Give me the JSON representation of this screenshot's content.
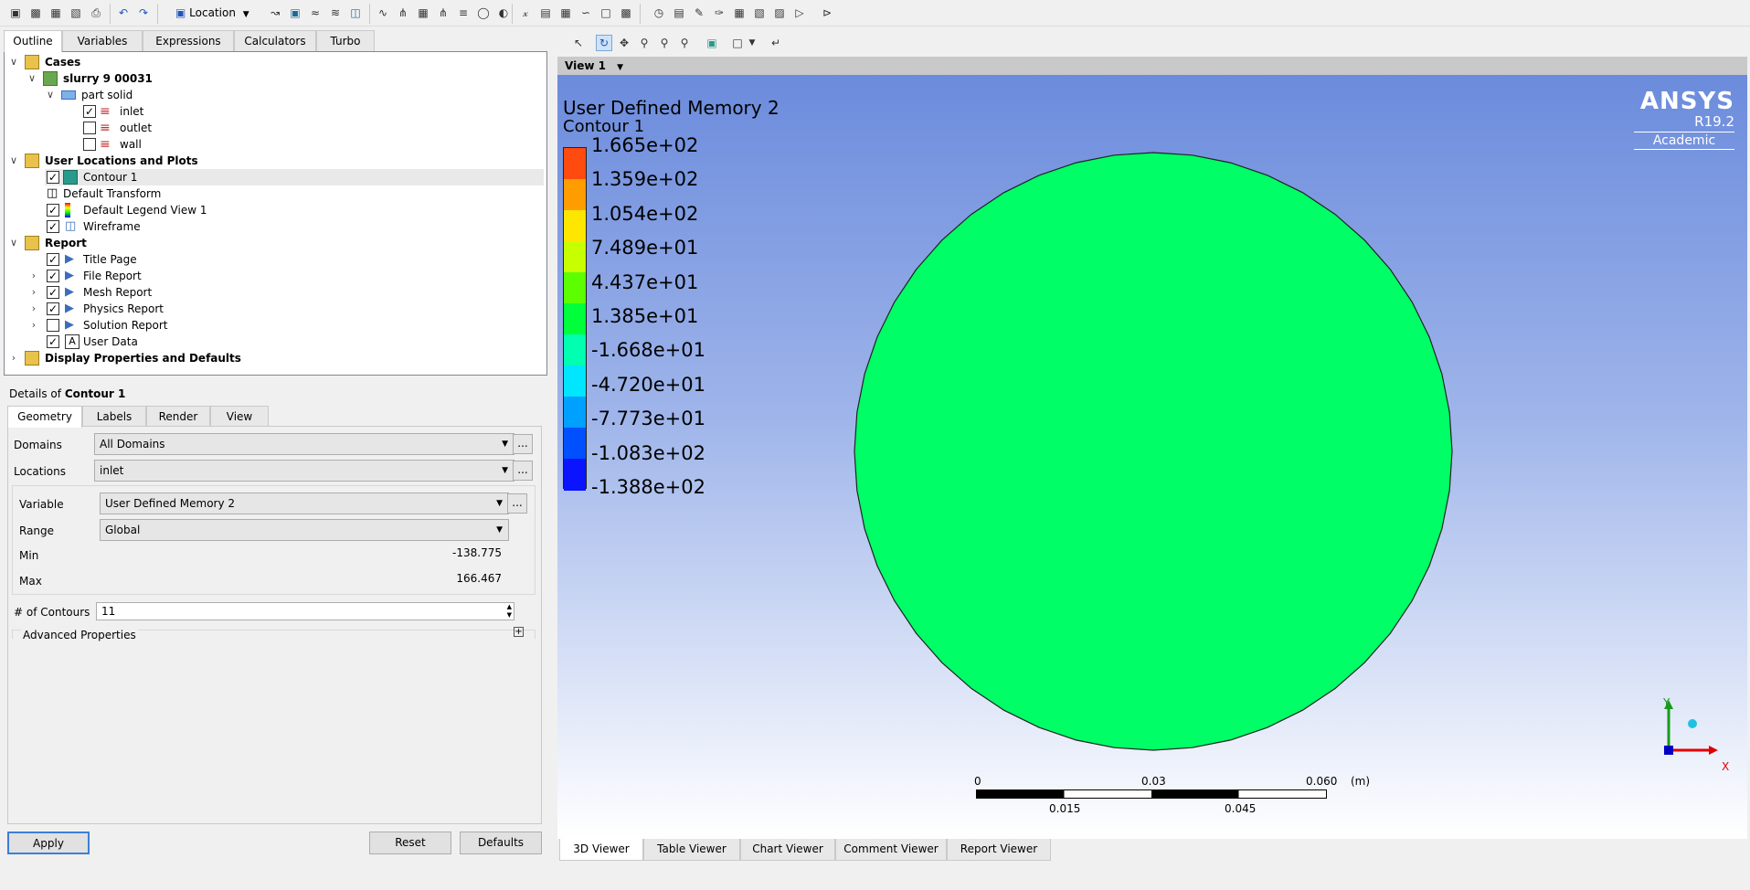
{
  "toolbar": {
    "location_label": "Location",
    "icons": [
      "new-file-icon",
      "open-file-icon",
      "load-state-icon",
      "save-state-icon",
      "print-icon",
      "undo-icon",
      "redo-icon",
      "location-icon",
      "vector-icon",
      "contour-icon",
      "streamline-icon",
      "volume-rendering-icon",
      "isosurface-icon",
      "polyline-icon",
      "surface-group-icon",
      "text-icon",
      "coordinate-frame-icon",
      "legend-icon",
      "instance-transform-icon",
      "clip-plane-icon",
      "color-map-icon",
      "variable-icon",
      "expression-icon",
      "table-icon",
      "chart-icon",
      "comment-icon",
      "figure-icon",
      "timestep-icon",
      "animation-icon",
      "quick-edit-icon",
      "probe-icon",
      "function-calculator-icon",
      "macro-calculator-icon",
      "mesh-calculator-icon",
      "command-editor-icon"
    ]
  },
  "outline_tabs": [
    "Outline",
    "Variables",
    "Expressions",
    "Calculators",
    "Turbo"
  ],
  "tree": {
    "cases_label": "Cases",
    "case_name": "slurry 9 00031",
    "part_label": "part solid",
    "boundaries": [
      {
        "label": "inlet",
        "checked": true
      },
      {
        "label": "outlet",
        "checked": false
      },
      {
        "label": "wall",
        "checked": false
      }
    ],
    "user_locations_label": "User Locations and Plots",
    "user_items": [
      {
        "label": "Contour 1",
        "checked": true,
        "icon": "contour-icon"
      },
      {
        "label": "Default Transform",
        "checked": null,
        "icon": "transform-icon"
      },
      {
        "label": "Default Legend View 1",
        "checked": true,
        "icon": "legend-icon"
      },
      {
        "label": "Wireframe",
        "checked": true,
        "icon": "wireframe-icon"
      }
    ],
    "report_label": "Report",
    "report_items": [
      {
        "label": "Title Page",
        "checked": true,
        "expand": false
      },
      {
        "label": "File Report",
        "checked": true,
        "expand": true
      },
      {
        "label": "Mesh Report",
        "checked": true,
        "expand": true
      },
      {
        "label": "Physics Report",
        "checked": true,
        "expand": true
      },
      {
        "label": "Solution Report",
        "checked": false,
        "expand": true
      },
      {
        "label": "User Data",
        "checked": true,
        "expand": false
      }
    ],
    "display_label": "Display Properties and Defaults"
  },
  "details": {
    "prefix": "Details of",
    "object": "Contour 1",
    "tabs": [
      "Geometry",
      "Labels",
      "Render",
      "View"
    ],
    "domains_label": "Domains",
    "domains_value": "All Domains",
    "locations_label": "Locations",
    "locations_value": "inlet",
    "variable_label": "Variable",
    "variable_value": "User Defined Memory 2",
    "range_label": "Range",
    "range_value": "Global",
    "min_label": "Min",
    "min_value": "-138.775",
    "max_label": "Max",
    "max_value": "166.467",
    "contours_label": "# of Contours",
    "contours_value": "11",
    "advanced_label": "Advanced Properties",
    "dots": "...",
    "apply": "Apply",
    "reset": "Reset",
    "defaults": "Defaults"
  },
  "viewer": {
    "view_title": "View 1",
    "legend_title": "User Defined Memory 2",
    "legend_subtitle": "Contour 1",
    "legend_values": [
      "1.665e+02",
      "1.359e+02",
      "1.054e+02",
      "7.489e+01",
      "4.437e+01",
      "1.385e+01",
      "-1.668e+01",
      "-4.720e+01",
      "-7.773e+01",
      "-1.083e+02",
      "-1.388e+02"
    ],
    "legend_colors": [
      "#ff4a10",
      "#ff9c00",
      "#ffe600",
      "#c8ff00",
      "#5cff00",
      "#00ff3a",
      "#00ffb0",
      "#00e6ff",
      "#00a0ff",
      "#0050ff",
      "#0a14ff"
    ],
    "contour_fill": "#00ff66",
    "brand": "ANSYS",
    "version": "R19.2",
    "edition": "Academic",
    "scale_top": [
      "0",
      "0.03",
      "0.060",
      "(m)"
    ],
    "scale_bottom": [
      "0.015",
      "0.045"
    ],
    "axis_y": "Y",
    "axis_x": "X",
    "bottom_tabs": [
      "3D Viewer",
      "Table Viewer",
      "Chart Viewer",
      "Comment Viewer",
      "Report Viewer"
    ]
  }
}
